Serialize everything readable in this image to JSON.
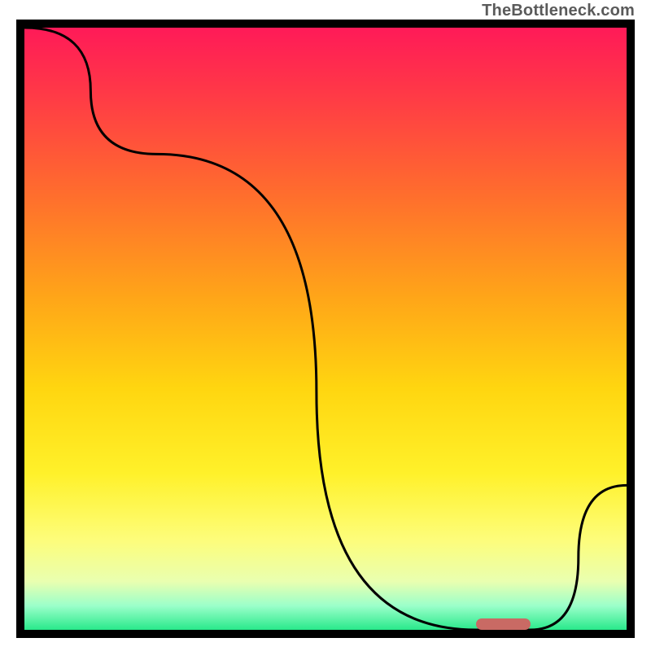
{
  "watermark": "TheBottleneck.com",
  "chart_data": {
    "type": "line",
    "title": "",
    "xlabel": "",
    "ylabel": "",
    "xlim": [
      0,
      100
    ],
    "ylim": [
      0,
      100
    ],
    "grid": false,
    "legend": false,
    "x": [
      0,
      22,
      75,
      84,
      100
    ],
    "values": [
      100,
      79,
      0,
      0,
      24
    ],
    "marker": {
      "x_start": 75,
      "x_end": 84,
      "y": 0
    },
    "background_gradient_stops": [
      {
        "pct": 0,
        "color": "#ff1a58"
      },
      {
        "pct": 10,
        "color": "#ff3648"
      },
      {
        "pct": 27,
        "color": "#ff6b2e"
      },
      {
        "pct": 45,
        "color": "#ffa618"
      },
      {
        "pct": 60,
        "color": "#ffd610"
      },
      {
        "pct": 74,
        "color": "#fff12a"
      },
      {
        "pct": 85,
        "color": "#fdfd7a"
      },
      {
        "pct": 92,
        "color": "#e9ffb0"
      },
      {
        "pct": 96,
        "color": "#9bffca"
      },
      {
        "pct": 100,
        "color": "#29e98b"
      }
    ]
  }
}
